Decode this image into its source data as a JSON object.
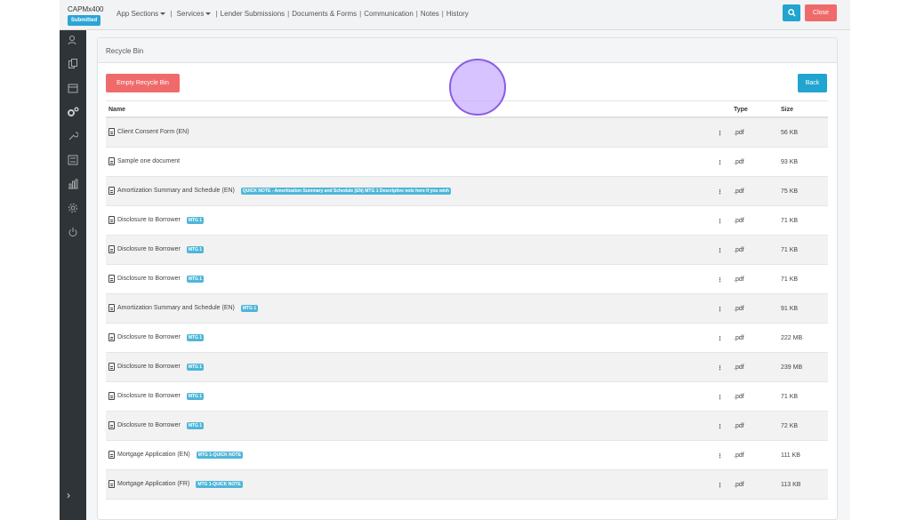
{
  "header": {
    "brand": "CAPMx400",
    "status_badge": "Submitted",
    "nav": {
      "app_sections": "App Sections",
      "services": "Services",
      "lender_submissions": "Lender Submissions",
      "documents_forms": "Documents & Forms",
      "communication": "Communication",
      "notes": "Notes",
      "history": "History"
    },
    "close_label": "Close"
  },
  "panel": {
    "title": "Recycle Bin",
    "empty_label": "Empty Recycle Bin",
    "back_label": "Back"
  },
  "table": {
    "columns": {
      "name": "Name",
      "type": "Type",
      "size": "Size"
    },
    "rows": [
      {
        "name": "Client Consent Form (EN)",
        "tag": "",
        "type": ".pdf",
        "size": "56 KB"
      },
      {
        "name": "Sample one document",
        "tag": "",
        "type": ".pdf",
        "size": "93 KB"
      },
      {
        "name": "Amortization Summary and Schedule (EN)",
        "tag": "QUICK NOTE - Amortization Summary and Schedule (EN) MTG 1 Descriptive note here if you wish",
        "type": ".pdf",
        "size": "75 KB"
      },
      {
        "name": "Disclosure to Borrower",
        "tag": "MTG 1",
        "type": ".pdf",
        "size": "71 KB"
      },
      {
        "name": "Disclosure to Borrower",
        "tag": "MTG 1",
        "type": ".pdf",
        "size": "71 KB"
      },
      {
        "name": "Disclosure to Borrower",
        "tag": "MTG 1",
        "type": ".pdf",
        "size": "71 KB"
      },
      {
        "name": "Amortization Summary and Schedule (EN)",
        "tag": "MTG 1",
        "type": ".pdf",
        "size": "91 KB"
      },
      {
        "name": "Disclosure to Borrower",
        "tag": "MTG 1",
        "type": ".pdf",
        "size": "222 MB"
      },
      {
        "name": "Disclosure to Borrower",
        "tag": "MTG 1",
        "type": ".pdf",
        "size": "239 MB"
      },
      {
        "name": "Disclosure to Borrower",
        "tag": "MTG 1",
        "type": ".pdf",
        "size": "71 KB"
      },
      {
        "name": "Disclosure to Borrower",
        "tag": "MTG 1",
        "type": ".pdf",
        "size": "72 KB"
      },
      {
        "name": "Mortgage Application (EN)",
        "tag": "MTG 1-QUICK NOTE",
        "type": ".pdf",
        "size": "111 KB"
      },
      {
        "name": "Mortgage Application (FR)",
        "tag": "MTG 1-QUICK NOTE",
        "type": ".pdf",
        "size": "113 KB"
      }
    ]
  },
  "sidebar": {
    "icons": [
      "users-icon",
      "documents-icon",
      "calendar-icon",
      "settings-cogs-icon",
      "wrench-icon",
      "list-icon",
      "bar-chart-icon",
      "gear-icon",
      "power-icon"
    ]
  },
  "colors": {
    "accent_blue": "#21a4cf",
    "danger_red": "#ef6b6b",
    "tag_blue": "#4fb6d9",
    "sidebar": "#2f3438"
  }
}
